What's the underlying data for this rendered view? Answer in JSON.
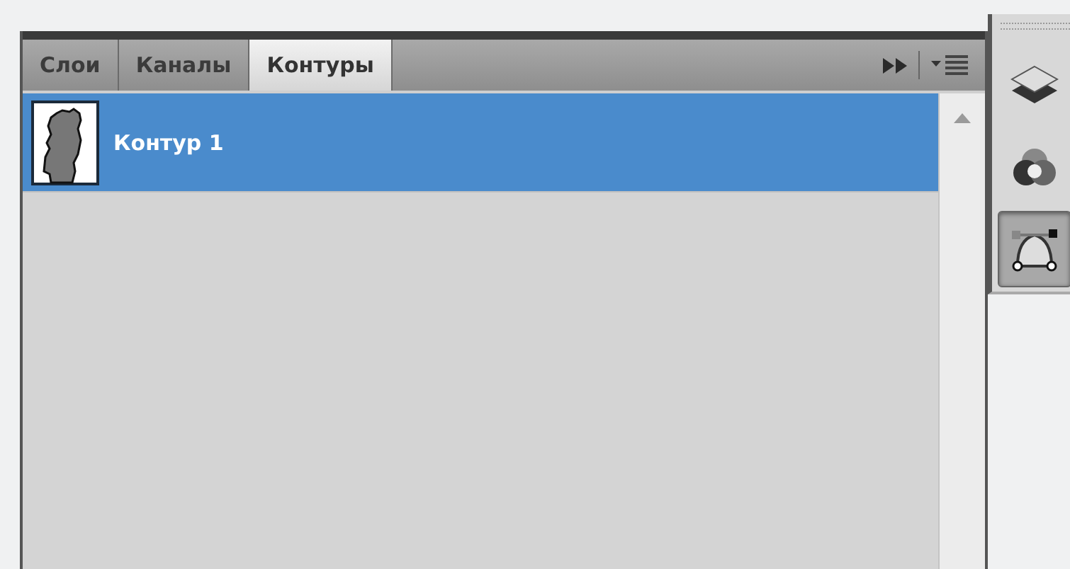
{
  "panel": {
    "tabs": [
      {
        "label": "Слои",
        "selected": false
      },
      {
        "label": "Каналы",
        "selected": false
      },
      {
        "label": "Контуры",
        "selected": true
      }
    ],
    "paths": [
      {
        "name": "Контур 1",
        "selected": true
      }
    ]
  },
  "dock": {
    "buttons": [
      {
        "kind": "layers",
        "selected": false
      },
      {
        "kind": "channels",
        "selected": false
      },
      {
        "kind": "paths",
        "selected": true
      }
    ]
  }
}
